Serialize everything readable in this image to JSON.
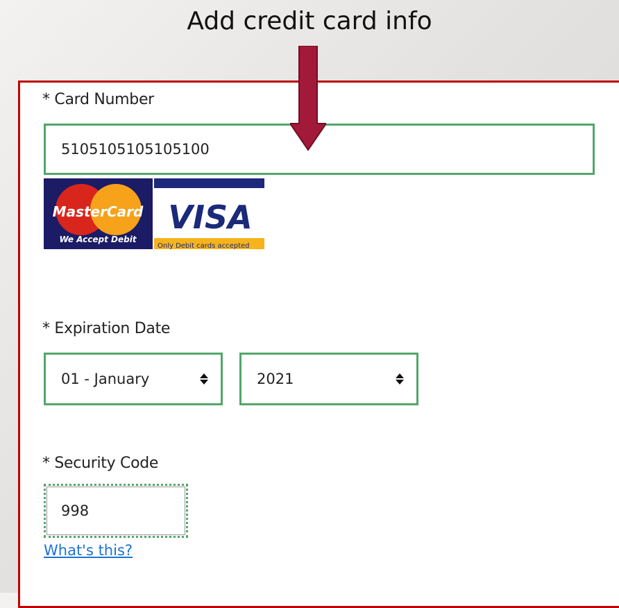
{
  "slide": {
    "title": "Add credit card info"
  },
  "form": {
    "card_number": {
      "label": "* Card Number",
      "value": "5105105105105100"
    },
    "card_logos": {
      "mastercard_text": "MasterCard",
      "mastercard_tagline": "We Accept Debit",
      "visa_text": "VISA",
      "visa_tagline": "Only Debit cards accepted"
    },
    "expiration": {
      "label": "* Expiration Date",
      "month": "01 - January",
      "year": "2021"
    },
    "security_code": {
      "label": "* Security Code",
      "value": "998",
      "help_link": "What's this?"
    }
  },
  "colors": {
    "panel_border": "#c00000",
    "input_border": "#52a66a",
    "arrow": "#a3193a",
    "link": "#1a73d1"
  }
}
